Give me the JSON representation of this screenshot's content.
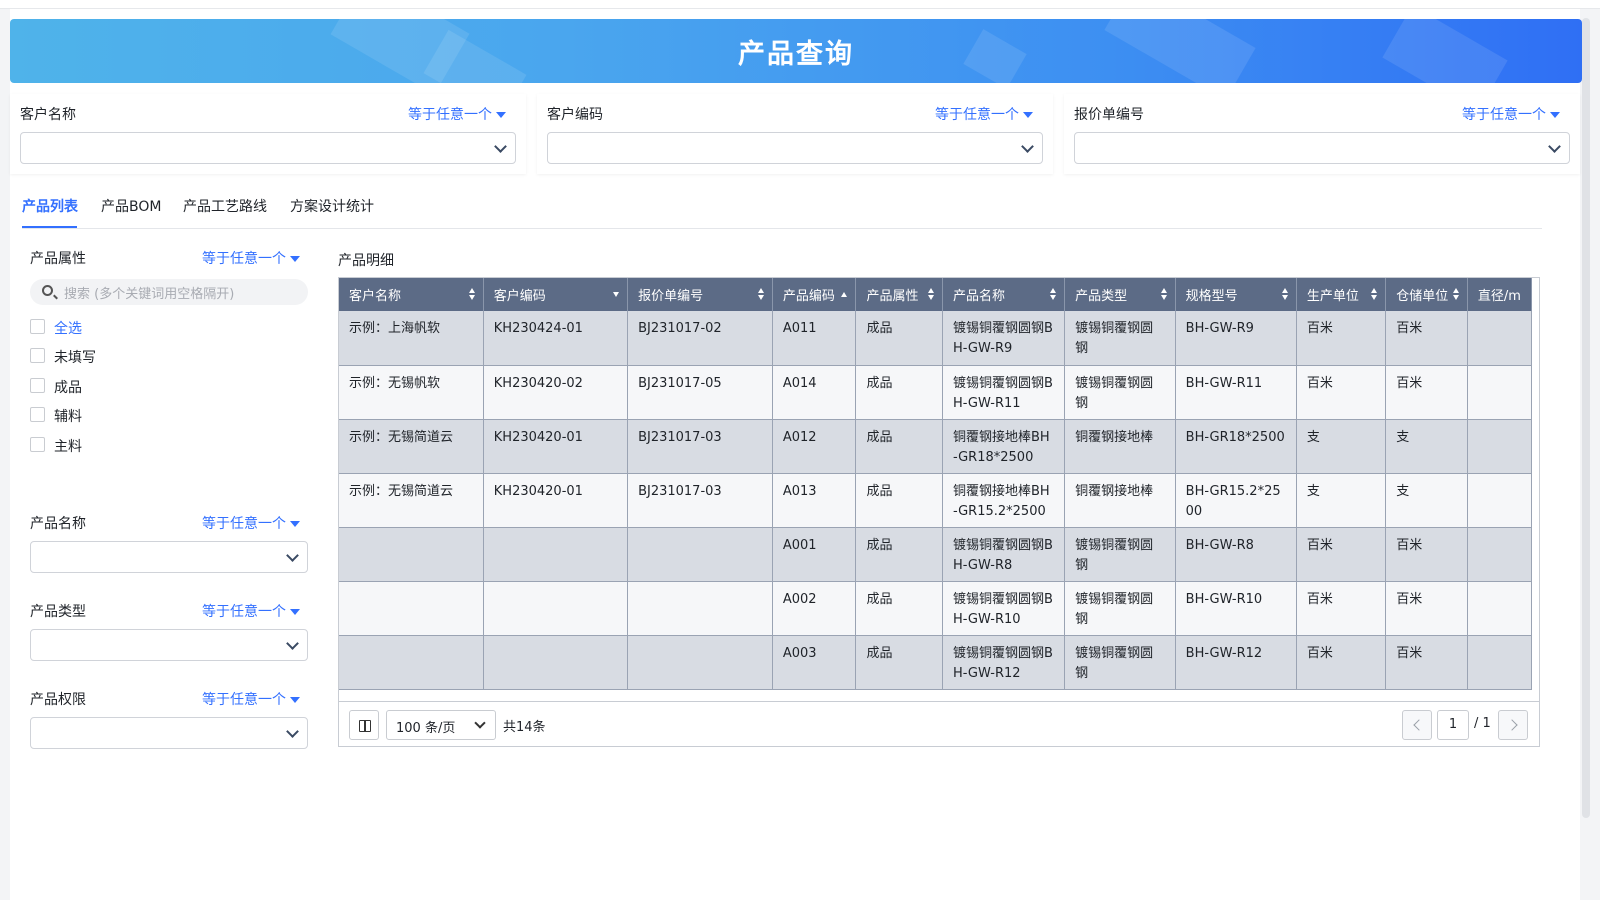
{
  "header": {
    "title": "产品查询"
  },
  "filters": [
    {
      "label": "客户名称",
      "operator": "等于任意一个"
    },
    {
      "label": "客户编码",
      "operator": "等于任意一个"
    },
    {
      "label": "报价单编号",
      "operator": "等于任意一个"
    }
  ],
  "tabs": [
    "产品列表",
    "产品BOM",
    "产品工艺路线",
    "方案设计统计"
  ],
  "sidebar": {
    "attr_label": "产品属性",
    "attr_operator": "等于任意一个",
    "search_placeholder": "搜索 (多个关键词用空格隔开)",
    "options": [
      "全选",
      "未填写",
      "成品",
      "辅料",
      "主料"
    ],
    "name_label": "产品名称",
    "name_operator": "等于任意一个",
    "type_label": "产品类型",
    "type_operator": "等于任意一个",
    "perm_label": "产品权限",
    "perm_operator": "等于任意一个"
  },
  "detail": {
    "title": "产品明细",
    "columns": [
      "客户名称",
      "客户编码",
      "报价单编号",
      "产品编码",
      "产品属性",
      "产品名称",
      "产品类型",
      "规格型号",
      "生产单位",
      "仓储单位",
      "直径/m"
    ],
    "sort_state": [
      "both",
      "desc",
      "both",
      "asc",
      "both",
      "both",
      "both",
      "both",
      "both",
      "both",
      "none"
    ],
    "rows": [
      [
        "示例：上海帆软",
        "KH230424-01",
        "BJ231017-02",
        "A011",
        "成品",
        "镀锡铜覆钢圆钢BH-GW-R9",
        "镀锡铜覆钢圆钢",
        "BH-GW-R9",
        "百米",
        "百米",
        ""
      ],
      [
        "示例：无锡帆软",
        "KH230420-02",
        "BJ231017-05",
        "A014",
        "成品",
        "镀锡铜覆钢圆钢BH-GW-R11",
        "镀锡铜覆钢圆钢",
        "BH-GW-R11",
        "百米",
        "百米",
        ""
      ],
      [
        "示例：无锡简道云",
        "KH230420-01",
        "BJ231017-03",
        "A012",
        "成品",
        "铜覆钢接地棒BH-GR18*2500",
        "铜覆钢接地棒",
        "BH-GR18*2500",
        "支",
        "支",
        ""
      ],
      [
        "示例：无锡简道云",
        "KH230420-01",
        "BJ231017-03",
        "A013",
        "成品",
        "铜覆钢接地棒BH-GR15.2*2500",
        "铜覆钢接地棒",
        "BH-GR15.2*2500",
        "支",
        "支",
        ""
      ],
      [
        "",
        "",
        "",
        "A001",
        "成品",
        "镀锡铜覆钢圆钢BH-GW-R8",
        "镀锡铜覆钢圆钢",
        "BH-GW-R8",
        "百米",
        "百米",
        ""
      ],
      [
        "",
        "",
        "",
        "A002",
        "成品",
        "镀锡铜覆钢圆钢BH-GW-R10",
        "镀锡铜覆钢圆钢",
        "BH-GW-R10",
        "百米",
        "百米",
        ""
      ],
      [
        "",
        "",
        "",
        "A003",
        "成品",
        "镀锡铜覆钢圆钢BH-GW-R12",
        "镀锡铜覆钢圆钢",
        "BH-GW-R12",
        "百米",
        "百米",
        ""
      ]
    ]
  },
  "pager": {
    "page_size": "100 条/页",
    "total": "共14条",
    "current_page": "1",
    "total_pages": "/ 1"
  },
  "colors": {
    "accent": "#3370ff",
    "header_bg": "#5c6b86",
    "row_odd": "#d8dce3",
    "row_even": "#f6f7f9"
  }
}
